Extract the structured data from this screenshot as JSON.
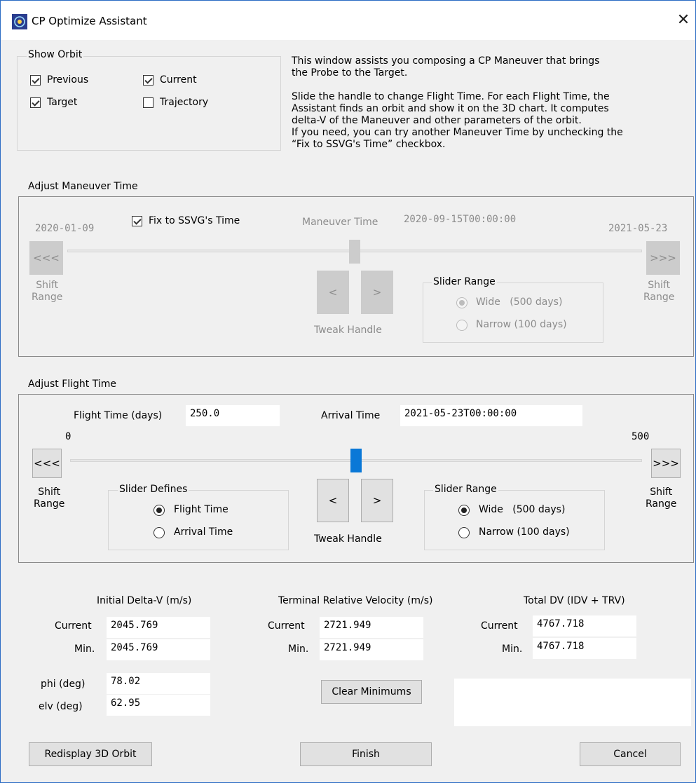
{
  "window": {
    "title": "CP Optimize Assistant",
    "close_icon": "close-icon",
    "app_icon": "orbit-app-icon"
  },
  "show_orbit": {
    "legend": "Show Orbit",
    "previous": {
      "label": "Previous",
      "checked": true
    },
    "current": {
      "label": "Current",
      "checked": true
    },
    "target": {
      "label": "Target",
      "checked": true
    },
    "trajectory": {
      "label": "Trajectory",
      "checked": false
    }
  },
  "description": {
    "para1": "This window assists you composing a CP Maneuver that brings\nthe Probe to the Target.",
    "para2": "Slide the handle to change Flight Time.  For each Flight Time, the\nAssistant finds an orbit and show it on the 3D chart. It computes\ndelta-V of the Maneuver and other parameters of the orbit.\nIf you need, you can try another Maneuver Time by unchecking the\n“Fix to SSVG's Time” checkbox."
  },
  "maneuver_time": {
    "legend": "Adjust Maneuver Time",
    "range_start": "2020-01-09",
    "range_end": "2021-05-23",
    "fix_label": "Fix to SSVG's Time",
    "fix_checked": true,
    "maneuver_time_label": "Maneuver Time",
    "maneuver_time_value": "2020-09-15T00:00:00",
    "shift_left": "<<<",
    "shift_right": ">>>",
    "shift_range_label": "Shift\nRange",
    "tweak_left": "<",
    "tweak_right": ">",
    "tweak_label": "Tweak Handle",
    "slider_fraction": 0.5,
    "slider_range": {
      "legend": "Slider Range",
      "wide": "Wide   (500 days)",
      "narrow": "Narrow (100 days)",
      "selected": "wide"
    }
  },
  "flight_time": {
    "legend": "Adjust Flight Time",
    "flight_time_label": "Flight Time (days)",
    "flight_time_value": "250.0",
    "arrival_time_label": "Arrival Time",
    "arrival_time_value": "2021-05-23T00:00:00",
    "range_min": "0",
    "range_max": "500",
    "slider_fraction": 0.5,
    "shift_left": "<<<",
    "shift_right": ">>>",
    "shift_range_label": "Shift\nRange",
    "tweak_left": "<",
    "tweak_right": ">",
    "tweak_label": "Tweak Handle",
    "slider_defines": {
      "legend": "Slider Defines",
      "flight_time": "Flight Time",
      "arrival_time": "Arrival Time",
      "selected": "flight_time"
    },
    "slider_range": {
      "legend": "Slider Range",
      "wide": "Wide   (500 days)",
      "narrow": "Narrow (100 days)",
      "selected": "wide"
    }
  },
  "results": {
    "idv": {
      "header": "Initial Delta-V (m/s)",
      "current_label": "Current",
      "current": "2045.769",
      "min_label": "Min.",
      "min": "2045.769"
    },
    "trv": {
      "header": "Terminal Relative Velocity (m/s)",
      "current_label": "Current",
      "current": "2721.949",
      "min_label": "Min.",
      "min": "2721.949"
    },
    "total": {
      "header": "Total DV (IDV + TRV)",
      "current_label": "Current",
      "current": "4767.718",
      "min_label": "Min.",
      "min": "4767.718"
    },
    "phi_label": "phi (deg)",
    "phi_value": "78.02",
    "elv_label": "elv (deg)",
    "elv_value": "62.95",
    "clear_minimums": "Clear Minimums",
    "message": ""
  },
  "footer": {
    "redisplay": "Redisplay 3D Orbit",
    "finish": "Finish",
    "cancel": "Cancel"
  },
  "colors": {
    "slider_thumb_active": "#0a78d7",
    "slider_thumb_disabled": "#cccccc",
    "window_border": "#2b6cc4"
  }
}
